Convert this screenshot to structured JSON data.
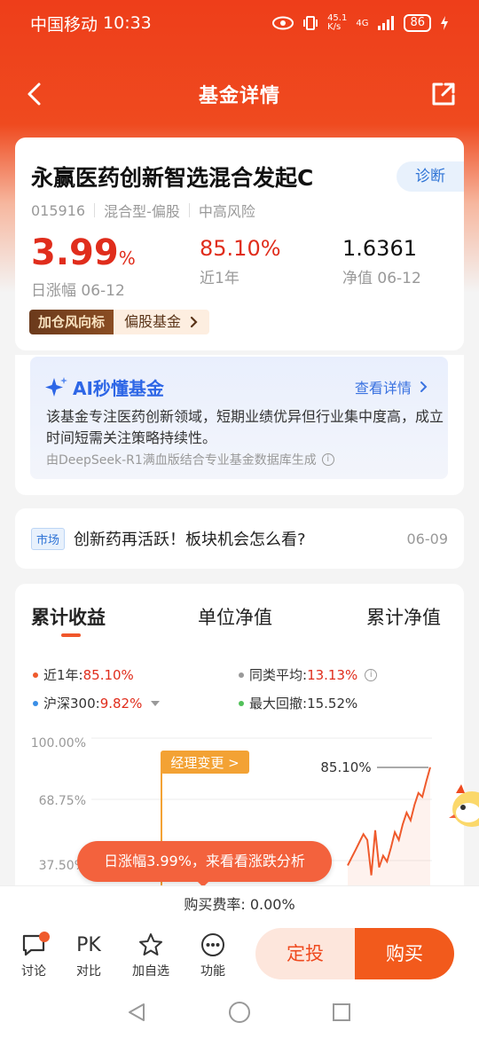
{
  "status_bar": {
    "carrier": "中国移动",
    "time": "10:33",
    "net_speed_top": "45.1",
    "net_speed_bottom": "K/s",
    "network": "4G",
    "battery": "86"
  },
  "nav": {
    "title": "基金详情"
  },
  "fund": {
    "name": "永赢医药创新智选混合发起C",
    "diagnose_label": "诊断",
    "code": "015916",
    "type": "混合型-偏股",
    "risk": "中高风险",
    "daily_change": "3.99",
    "daily_change_unit": "%",
    "daily_change_label": "日涨幅 06-12",
    "one_year_return": "85.10%",
    "one_year_label": "近1年",
    "nav_value": "1.6361",
    "nav_label": "净值 06-12",
    "tag_dark": "加仓风向标",
    "tag_light": "偏股基金"
  },
  "ai": {
    "title": "AI秒懂基金",
    "link": "查看详情",
    "text": "该基金专注医药创新领域，短期业绩优异但行业集中度高，成立时间短需关注策略持续性。",
    "source": "由DeepSeek-R1满血版结合专业基金数据库生成"
  },
  "news": {
    "tag": "市场",
    "text": "创新药再活跃！板块机会怎么看?",
    "date": "06-09"
  },
  "chart_tabs": {
    "tab1": "累计收益",
    "tab2": "单位净值",
    "tab3": "累计净值"
  },
  "legend": {
    "fund_label": "近1年:",
    "fund_value": "85.10%",
    "peer_label": "同类平均:",
    "peer_value": "13.13%",
    "hs300_label": "沪深300:",
    "hs300_value": "9.82%",
    "drawdown_label": "最大回撤:",
    "drawdown_value": "15.52%"
  },
  "chart_data": {
    "type": "line",
    "y_ticks": [
      "100.00%",
      "68.75%",
      "37.50%"
    ],
    "annotation": "经理变更 >",
    "end_label": "85.10%",
    "series": [
      {
        "name": "近1年",
        "values": [
          10,
          14,
          18,
          22,
          26,
          23,
          30,
          28,
          34,
          40,
          37,
          44,
          52,
          48,
          56,
          62,
          58,
          66,
          72,
          70,
          78,
          85.1
        ]
      }
    ],
    "colors": {
      "fund": "#ef5a2c",
      "peer": "#999999",
      "hs300": "#3a8ee6",
      "drawdown": "#52c05a",
      "annotation": "#f3a234"
    }
  },
  "toast": {
    "text": "日涨幅3.99%，来看看涨跌分析"
  },
  "fee": {
    "label": "购买费率: ",
    "value": "0.00%"
  },
  "bottom_bar": {
    "discuss": "讨论",
    "compare_icon_text": "PK",
    "compare": "对比",
    "watch": "加自选",
    "functions": "功能",
    "fixed_invest": "定投",
    "buy": "购买"
  }
}
